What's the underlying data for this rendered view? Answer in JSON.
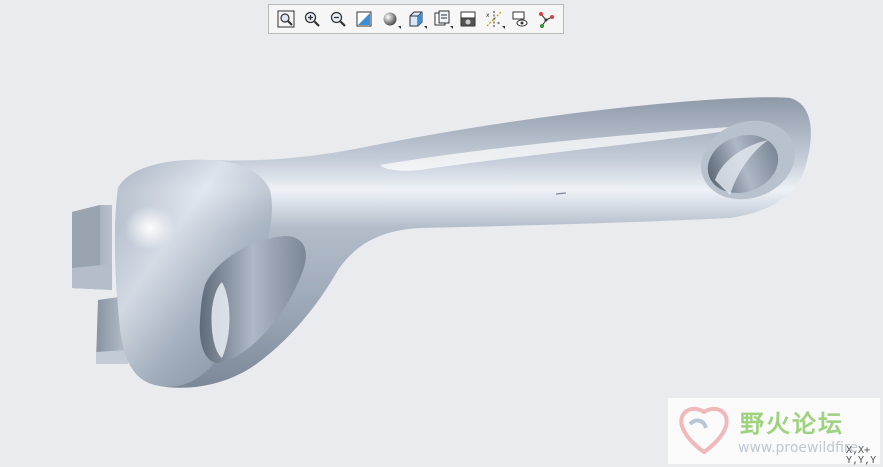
{
  "toolbar": {
    "buttons": [
      {
        "name": "refit-view",
        "icon": "zoom-fit-icon",
        "flyout": false
      },
      {
        "name": "zoom-in",
        "icon": "zoom-in-icon",
        "flyout": false
      },
      {
        "name": "zoom-out",
        "icon": "zoom-out-icon",
        "flyout": false
      },
      {
        "name": "repaint",
        "icon": "repaint-icon",
        "flyout": false
      },
      {
        "name": "display-style",
        "icon": "shading-sphere-icon",
        "flyout": true
      },
      {
        "name": "saved-orientations",
        "icon": "view-cube-icon",
        "flyout": true
      },
      {
        "name": "view-manager",
        "icon": "view-manager-icon",
        "flyout": true
      },
      {
        "name": "perspective-view",
        "icon": "camera-icon",
        "flyout": false
      },
      {
        "name": "datum-display",
        "icon": "datum-axes-icon",
        "flyout": true
      },
      {
        "name": "annotation-display",
        "icon": "annotation-eye-icon",
        "flyout": false
      },
      {
        "name": "spin-center",
        "icon": "spin-center-icon",
        "flyout": false
      }
    ]
  },
  "watermark": {
    "title_cn": "野火论坛",
    "url": "www.proewildfire"
  },
  "triad": {
    "line1": "X,X+",
    "line2": "Y,Y,Y"
  },
  "colors": {
    "background": "#e9ebef",
    "model": "#a9b4c2",
    "watermark_green": "#9fd27e"
  }
}
